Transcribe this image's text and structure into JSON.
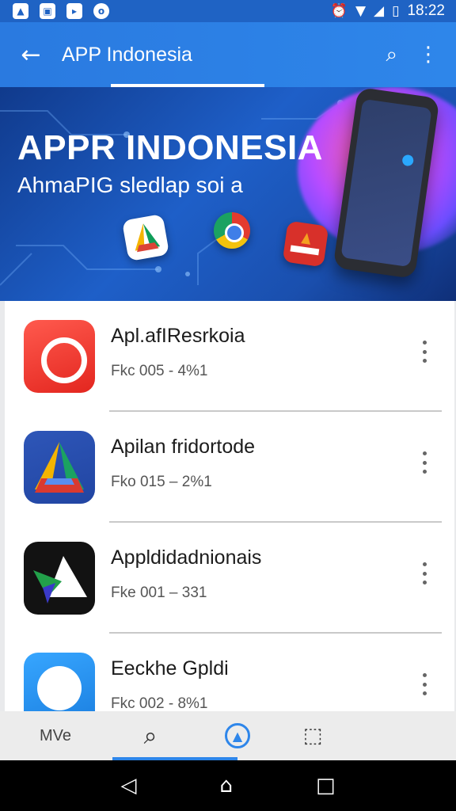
{
  "status_bar": {
    "time": "18:22",
    "left_icons": [
      "app-notification-icon",
      "image-notification-icon",
      "media-notification-icon",
      "circle-notification-icon"
    ],
    "right_icons": [
      "alarm-icon",
      "wifi-icon",
      "signal-icon",
      "battery-icon"
    ]
  },
  "app_bar": {
    "title": "APP Indonesia",
    "back_icon": "←",
    "search_icon": "⌕",
    "more_icon": "⋮"
  },
  "banner": {
    "title": "APPR INDONESIA",
    "subtitle": "AhmaPIG sledlap soi a"
  },
  "apps": [
    {
      "name": "Apl.afIResrkoia",
      "meta": "Fkc 005 - 4%1",
      "icon": "red-app-icon"
    },
    {
      "name": "Apilan fridortode",
      "meta": "Fko 015 – 2%1",
      "icon": "drive-app-icon"
    },
    {
      "name": "Appldidadnionais",
      "meta": "Fke 001 – 331",
      "icon": "black-app-icon"
    },
    {
      "name": "Eeckhe Gpldi",
      "meta": "Fkc 002 - 8%1",
      "icon": "blue-app-icon"
    }
  ],
  "bottom_nav": {
    "item1_label": "MVe",
    "item2_icon": "⌕",
    "item3_icon": "▲",
    "item4_icon": "⬚"
  },
  "system_nav": {
    "back": "◁",
    "home": "⌂",
    "recents": "□"
  },
  "colors": {
    "primary": "#2e86ea",
    "status_bar": "#1f63c4",
    "banner_dark": "#103a8c"
  }
}
